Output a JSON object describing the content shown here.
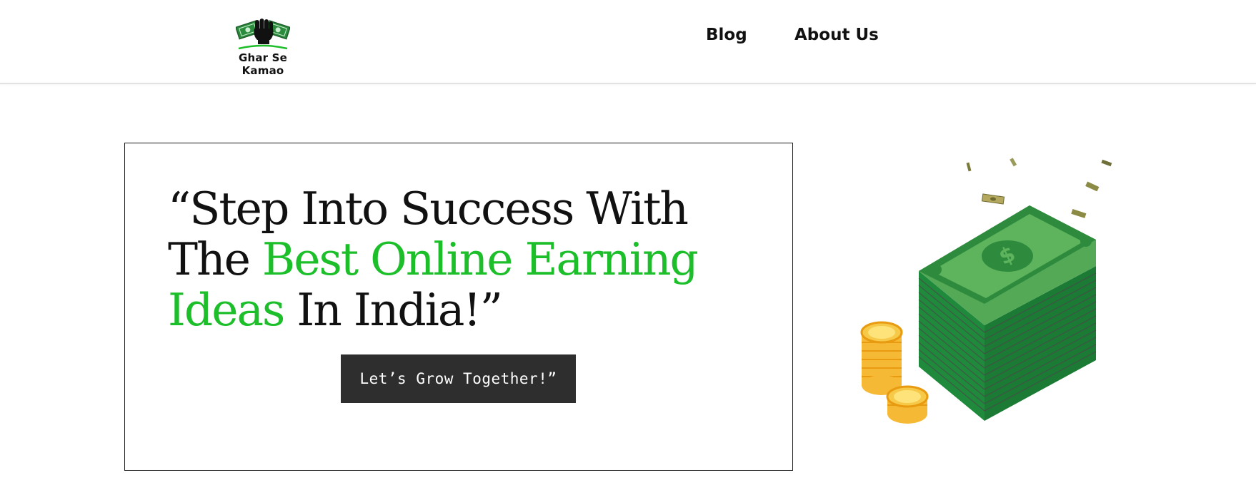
{
  "brand": {
    "name": "Ghar Se Kamao",
    "accent_color": "#1cbf2a",
    "logo_icon": "fist-with-cash-icon"
  },
  "nav": {
    "items": [
      {
        "label": "Blog"
      },
      {
        "label": "About Us"
      }
    ]
  },
  "hero": {
    "heading_part1": "“Step Into Success With The ",
    "heading_highlight": "Best Online Earning Ideas",
    "heading_part2": " In India!”",
    "cta_label": "Let’s Grow Together!”",
    "cta_bg": "#2e2e2e",
    "illustration": "money-stack-and-coins-illustration"
  }
}
